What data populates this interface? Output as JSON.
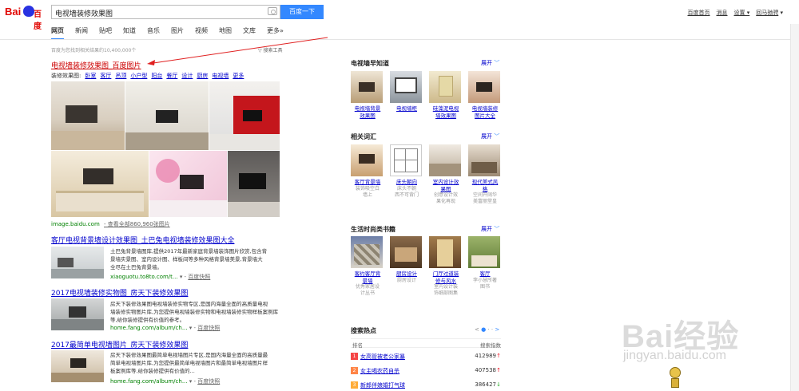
{
  "logo": {
    "left": "Bai",
    "right": "百度",
    "paw": "du"
  },
  "search": {
    "query": "电视墙装修效果图",
    "button": "百度一下"
  },
  "toplinks": [
    "百度首页",
    "消息",
    "设置",
    "回马驰骋"
  ],
  "nav": [
    {
      "label": "网页",
      "active": true
    },
    {
      "label": "新闻"
    },
    {
      "label": "贴吧"
    },
    {
      "label": "知道"
    },
    {
      "label": "音乐"
    },
    {
      "label": "图片"
    },
    {
      "label": "视频"
    },
    {
      "label": "地图"
    },
    {
      "label": "文库"
    },
    {
      "label": "更多»"
    }
  ],
  "result_count": "百度为您找到相关结果约10,400,000个",
  "search_tools": "搜索工具",
  "results": {
    "r1": {
      "title": "电视墙装修效果图_百度图片",
      "sub_label": "装修效果图:",
      "sublinks": [
        "卧室",
        "客厅",
        "吊顶",
        "小户型",
        "阳台",
        "餐厅",
        "设计",
        "厨房",
        "电视墙",
        "更多"
      ],
      "source": "image.baidu.com",
      "more": "- 查看全部860,960张图片"
    },
    "r2": {
      "title": "客厅电视背景墙设计效果图_土巴兔电视墙装修效果图大全",
      "desc_lines": [
        "土巴兔背景墙图库,提供2017年最新家庭背景墙装饰图片欣赏,包含背",
        "景墙实景图、室内设计图、样板间等多种风格背景墙美景,背景墙大",
        "全尽在土巴兔背景墙。"
      ],
      "source": "xiaoguotu.to8to.com/t...",
      "snap": "百度快照"
    },
    "r3": {
      "title": "2017电视墙装修实物图_房天下装修效果图",
      "desc_lines": [
        "房天下装修效果图电视墙装修实物专区,是国内海量全面的高质量电视",
        "墙装修实物图片库,为您提供电视墙装修实物和电视墙装修实物样板案例库",
        "等,给你装修提供有价值的参考。"
      ],
      "source": "home.fang.com/album/ch...",
      "snap": "百度快照"
    },
    "r4": {
      "title": "2017最简单电视墙图片_房天下装修效果图",
      "desc_lines": [
        "房天下装修效果图最简单电视墙图片专区,是国内海量全面的高质量最",
        "简单电视墙图片库,为您提供最简单电视墙图片和最简单电视墙图片样",
        "板案例库等,给你装修提供有价值的..."
      ],
      "source": "home.fang.com/album/ch...",
      "snap": "百度快照"
    }
  },
  "sidebar": {
    "expand": "展开",
    "know": {
      "title": "电视墙早知道",
      "cards": [
        {
          "t1": "电视墙背景",
          "t2": "效果图"
        },
        {
          "t1": "电视墙柜",
          "t2": ""
        },
        {
          "t1": "硅藻泥电视",
          "t2": "墙效果图"
        },
        {
          "t1": "电视墙装修",
          "t2": "图片大全"
        }
      ]
    },
    "related": {
      "title": "相关词汇",
      "cards": [
        {
          "t1": "客厅背景墙",
          "s1": "装饰吸空白",
          "s2": "墙上"
        },
        {
          "t1": "床头朝向",
          "s1": "床头不朝",
          "s2": "西不可背门"
        },
        {
          "t1": "室内设计效",
          "t2": "果图",
          "s1": "创意设计效",
          "s2": "果化再现"
        },
        {
          "t1": "现代美式风",
          "t2": "格",
          "s1": "空间开阔华",
          "s2": "美富丽堂皇"
        }
      ]
    },
    "books": {
      "title": "生活时尚类书籍",
      "cards": [
        {
          "t1": "客约客厅背",
          "t2": "景墙",
          "s1": "优秀家居设",
          "s2": "计丛书"
        },
        {
          "t1": "厨房设计",
          "s1": "厨房设计",
          "s2": ""
        },
        {
          "t1": "门厅过道装",
          "t2": "修与风水",
          "s1": "室内设计装",
          "s2": "饰细部图集"
        },
        {
          "t1": "客厅",
          "s1": "李小慧所著",
          "s2": "图书"
        }
      ]
    },
    "hot": {
      "title": "搜索热点",
      "col1": "排名",
      "col2": "搜索指数",
      "rows": [
        {
          "rank": "1",
          "kw": "女高管被老公家暴",
          "val": "412989",
          "trend": "up",
          "color": "#f54545"
        },
        {
          "rank": "2",
          "kw": "女主喝农药自杀",
          "val": "407538",
          "trend": "up",
          "color": "#ff8547"
        },
        {
          "rank": "3",
          "kw": "新郎伴娘婚打气球",
          "val": "386427",
          "trend": "down",
          "color": "#ffac38"
        }
      ]
    }
  },
  "watermark": {
    "text": "Bai经验",
    "url": "jingyan.baidu.com"
  }
}
